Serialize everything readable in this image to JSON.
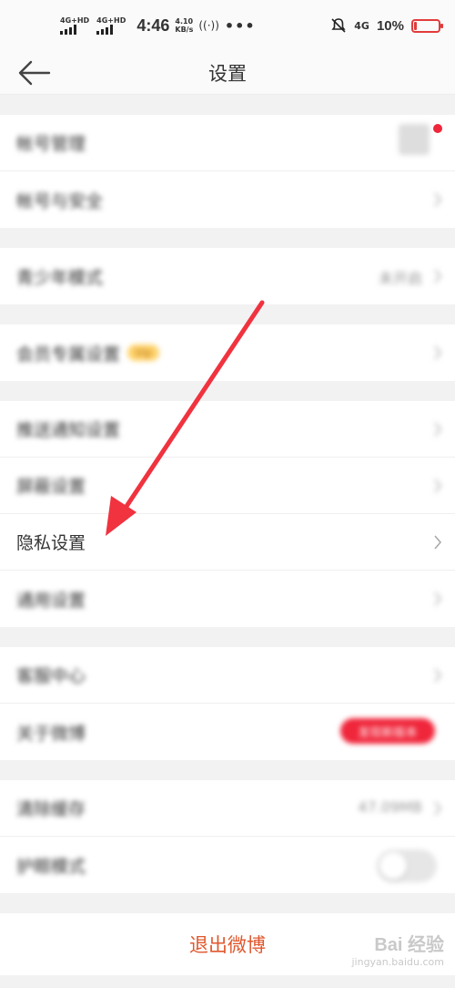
{
  "status_bar": {
    "sim1": "4G+HD",
    "sim2": "4G+HD",
    "time": "4:46",
    "speed_value": "4.10",
    "speed_unit": "KB/s",
    "more": "•••",
    "net": "4G",
    "battery": "10%",
    "battery_level": 0.1,
    "battery_color": "#e23b3b"
  },
  "header": {
    "title": "设置"
  },
  "groups": [
    {
      "rows": [
        {
          "label": "帐号管理",
          "blurred": true,
          "extra": "avatar"
        },
        {
          "label": "帐号与安全",
          "blurred": true
        }
      ]
    },
    {
      "rows": [
        {
          "label": "青少年模式",
          "blurred": true,
          "value": "未开启"
        }
      ]
    },
    {
      "rows": [
        {
          "label": "会员专属设置",
          "blurred": true,
          "badge": "Vip"
        }
      ]
    },
    {
      "rows": [
        {
          "label": "推送通知设置",
          "blurred": true
        },
        {
          "label": "屏蔽设置",
          "blurred": true
        },
        {
          "label": "隐私设置",
          "blurred": false
        },
        {
          "label": "通用设置",
          "blurred": true
        }
      ]
    },
    {
      "rows": [
        {
          "label": "客服中心",
          "blurred": true
        },
        {
          "label": "关于微博",
          "blurred": true,
          "pill": "发现新版本"
        }
      ]
    },
    {
      "rows": [
        {
          "label": "清除缓存",
          "blurred": true,
          "value": "47.09MB"
        },
        {
          "label": "护眼模式",
          "blurred": true,
          "extra": "toggle"
        }
      ]
    }
  ],
  "logout": "退出微博",
  "watermark": {
    "title": "Bai 经验",
    "sub": "jingyan.baidu.com"
  },
  "colors": {
    "accent_red": "#f0263b",
    "logout_text": "#e0582e",
    "arrow": "#f0333f"
  },
  "icons": [
    "back-arrow-icon",
    "chevron-right-icon",
    "signal-icon",
    "hotspot-icon",
    "mute-icon",
    "battery-icon"
  ]
}
